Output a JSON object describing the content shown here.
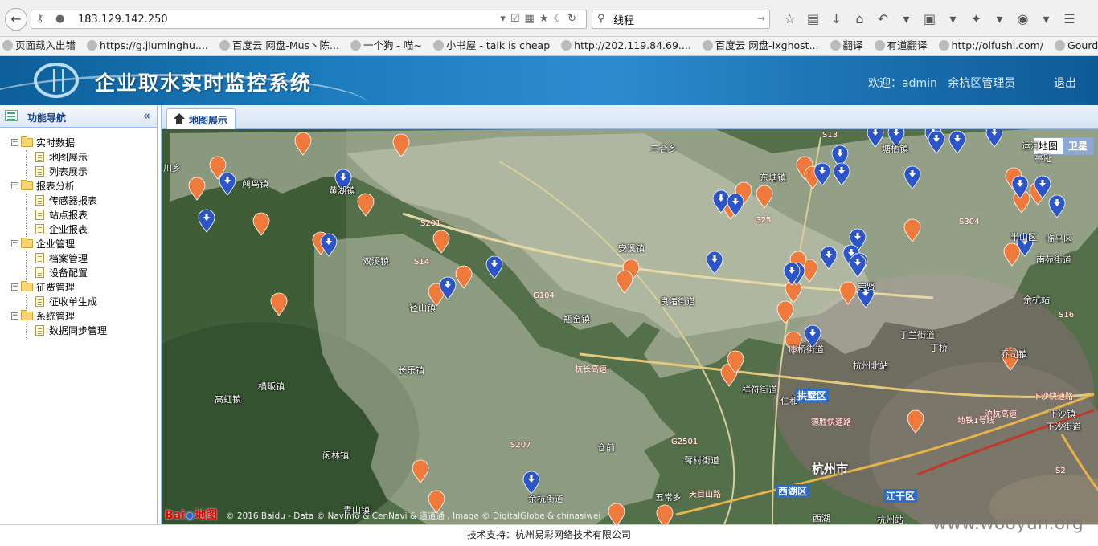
{
  "browser": {
    "url": "183.129.142.250",
    "search_value": "线程",
    "bookmarks": [
      "页面载入出错",
      "https://g.jiuminghu....",
      "百度云 网盘-Mus丶陈...",
      "一个狗 - 喵~",
      "小书屋 - talk is cheap",
      "http://202.119.84.69....",
      "百度云 网盘-lxghost...",
      "翻译",
      "有道翻译",
      "http://olfushi.com/",
      "GourdScan"
    ]
  },
  "header": {
    "title": "企业取水实时监控系统",
    "welcome": "欢迎：admin   余杭区管理员",
    "logout": "退出"
  },
  "sidebar": {
    "title": "功能导航",
    "groups": [
      {
        "label": "实时数据",
        "items": [
          "地图展示",
          "列表展示"
        ]
      },
      {
        "label": "报表分析",
        "items": [
          "传感器报表",
          "站点报表",
          "企业报表"
        ]
      },
      {
        "label": "企业管理",
        "items": [
          "档案管理",
          "设备配置"
        ]
      },
      {
        "label": "征费管理",
        "items": [
          "征收单生成"
        ]
      },
      {
        "label": "系统管理",
        "items": [
          "数据同步管理"
        ]
      }
    ]
  },
  "tabs": [
    {
      "label": "地图展示"
    }
  ],
  "map": {
    "type_control": {
      "map": "地图",
      "satellite": "卫星"
    },
    "brand": "Bai地图",
    "copyright": "© 2016 Baidu - Data © NavInfo & CenNavi & 道道通 , Image © DigitalGlobe & chinasiwei",
    "places": [
      "三合乡",
      "鸬鸟镇",
      "黄湖镇",
      "双溪镇",
      "径山镇",
      "瓶窑镇",
      "良渚街道",
      "安溪镇",
      "长乐镇",
      "横畈镇",
      "高虹镇",
      "仓前",
      "余杭街道",
      "五常乡",
      "青山镇",
      "东塘镇",
      "塘栖镇",
      "崇贤",
      "丁兰街道",
      "丁桥",
      "余杭站",
      "杭州北站",
      "祥符街道",
      "蒋村街道",
      "半山区",
      "南苑街道",
      "下沙镇",
      "下沙街道",
      "西湖",
      "杭州站",
      "乔司镇",
      "康桥街道",
      "临平区",
      "川乡",
      "运河",
      "亭趾",
      "闲林镇",
      "仁和"
    ],
    "districts": [
      "拱墅区",
      "西湖区",
      "江干区",
      "杭州市"
    ],
    "roads": [
      "S201",
      "S14",
      "G104",
      "G25",
      "S13",
      "S304",
      "S207",
      "G2501",
      "S16",
      "S2",
      "德胜快速路",
      "地铁1号线",
      "天目山路",
      "沪杭高速",
      "杭长高速",
      "下沙快速路"
    ]
  },
  "footer": {
    "text": "技术支持：杭州易彩网络技术有限公司"
  },
  "watermark": "www.wooyun.org",
  "colors": {
    "header_blue": "#1c7cbd",
    "marker_orange": "#f07a3c",
    "marker_blue": "#2b55c8",
    "sidebar_title": "#15428b"
  }
}
